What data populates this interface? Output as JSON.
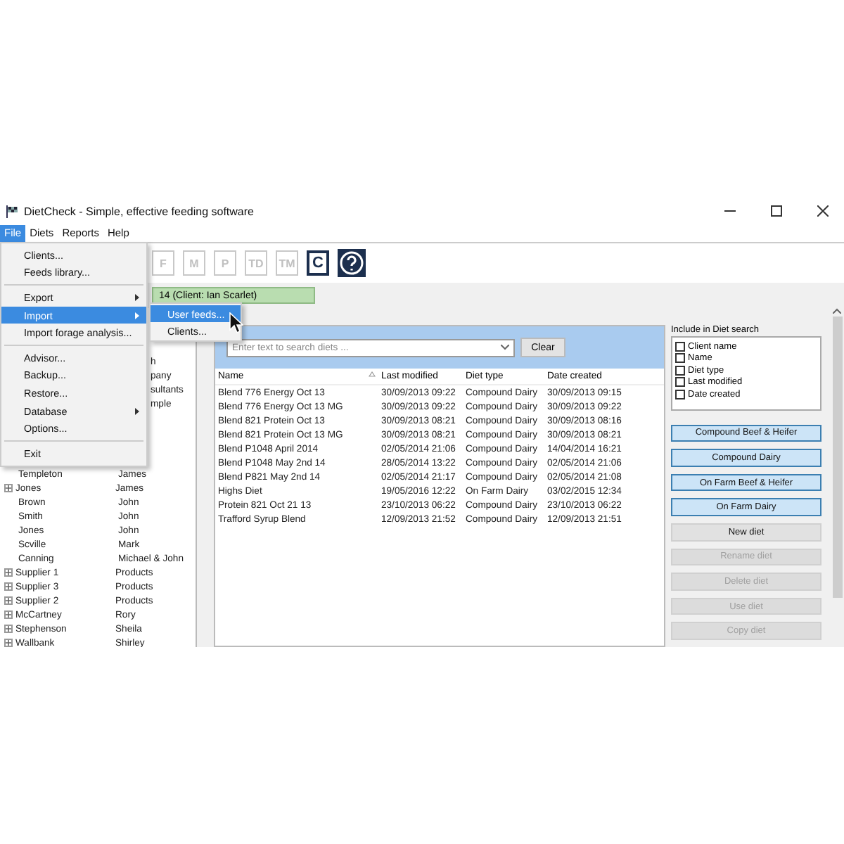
{
  "window": {
    "title": "DietCheck - Simple, effective feeding software"
  },
  "menu_bar": [
    {
      "label": "File",
      "selected": true
    },
    {
      "label": "Diets",
      "selected": false
    },
    {
      "label": "Reports",
      "selected": false
    },
    {
      "label": "Help",
      "selected": false
    }
  ],
  "file_menu": [
    {
      "kind": "item",
      "label": "Clients...",
      "selected": false,
      "submenu": false
    },
    {
      "kind": "item",
      "label": "Feeds library...",
      "selected": false,
      "submenu": false
    },
    {
      "kind": "separator"
    },
    {
      "kind": "item",
      "label": "Export",
      "selected": false,
      "submenu": true
    },
    {
      "kind": "item",
      "label": "Import",
      "selected": true,
      "submenu": true
    },
    {
      "kind": "item",
      "label": "Import forage analysis...",
      "selected": false,
      "submenu": false
    },
    {
      "kind": "separator"
    },
    {
      "kind": "item",
      "label": "Advisor...",
      "selected": false,
      "submenu": false
    },
    {
      "kind": "item",
      "label": "Backup...",
      "selected": false,
      "submenu": false
    },
    {
      "kind": "item",
      "label": "Restore...",
      "selected": false,
      "submenu": false
    },
    {
      "kind": "item",
      "label": "Database",
      "selected": false,
      "submenu": true
    },
    {
      "kind": "item",
      "label": "Options...",
      "selected": false,
      "submenu": false
    },
    {
      "kind": "separator"
    },
    {
      "kind": "item",
      "label": "Exit",
      "selected": false,
      "submenu": false
    }
  ],
  "import_submenu": [
    {
      "label": "User feeds...",
      "selected": true
    },
    {
      "label": "Clients...",
      "selected": false
    }
  ],
  "toolbar": [
    {
      "label": "F",
      "disabled": true
    },
    {
      "label": "M",
      "disabled": true
    },
    {
      "label": "P",
      "disabled": true
    },
    {
      "label": "TD",
      "disabled": true
    },
    {
      "label": "TM",
      "disabled": true
    },
    {
      "label": "C",
      "disabled": false
    }
  ],
  "banner": "14 (Client: Ian Scarlet)",
  "clients": [
    {
      "column_2": "h"
    },
    {
      "column_2": "pany"
    },
    {
      "column_2": "sultants"
    },
    {
      "column_2": "mple"
    },
    {
      "name": "Templeton",
      "first": "James",
      "expandable": false
    },
    {
      "name": "Jones",
      "first": "James",
      "expandable": true
    },
    {
      "name": "Brown",
      "first": "John",
      "expandable": false
    },
    {
      "name": "Smith",
      "first": "John",
      "expandable": false
    },
    {
      "name": "Jones",
      "first": "John",
      "expandable": false
    },
    {
      "name": "Scville",
      "first": "Mark",
      "expandable": false
    },
    {
      "name": "Canning",
      "first": "Michael & John",
      "expandable": false
    },
    {
      "name": "Supplier 1",
      "first": "Products",
      "expandable": true
    },
    {
      "name": "Supplier 3",
      "first": "Products",
      "expandable": true
    },
    {
      "name": "Supplier 2",
      "first": "Products",
      "expandable": true
    },
    {
      "name": "McCartney",
      "first": "Rory",
      "expandable": true
    },
    {
      "name": "Stephenson",
      "first": "Sheila",
      "expandable": true
    },
    {
      "name": "Wallbank",
      "first": "Shirley",
      "expandable": true
    }
  ],
  "search": {
    "placeholder": "Enter text to search diets ...",
    "button": "Clear"
  },
  "table": {
    "columns": [
      "Name",
      "Last modified",
      "Diet type",
      "Date created"
    ],
    "rows": [
      [
        "Blend 776 Energy Oct 13",
        "30/09/2013 09:22",
        "Compound Dairy",
        "30/09/2013 09:15"
      ],
      [
        "Blend 776 Energy Oct 13 MG",
        "30/09/2013 09:22",
        "Compound Dairy",
        "30/09/2013 09:22"
      ],
      [
        "Blend 821 Protein Oct 13",
        "30/09/2013 08:21",
        "Compound Dairy",
        "30/09/2013 08:16"
      ],
      [
        "Blend 821 Protein Oct 13 MG",
        "30/09/2013 08:21",
        "Compound Dairy",
        "30/09/2013 08:21"
      ],
      [
        "Blend P1048 April 2014",
        "02/05/2014 21:06",
        "Compound Dairy",
        "14/04/2014 16:21"
      ],
      [
        "Blend P1048 May 2nd 14",
        "28/05/2014 13:22",
        "Compound Dairy",
        "02/05/2014 21:06"
      ],
      [
        "Blend P821 May 2nd 14",
        "02/05/2014 21:17",
        "Compound Dairy",
        "02/05/2014 21:08"
      ],
      [
        "Highs Diet",
        "19/05/2016 12:22",
        "On Farm Dairy",
        "03/02/2015 12:34"
      ],
      [
        "Protein 821 Oct 21 13",
        "23/10/2013 06:22",
        "Compound Dairy",
        "23/10/2013 06:22"
      ],
      [
        "Trafford Syrup Blend",
        "12/09/2013 21:52",
        "Compound Dairy",
        "12/09/2013 21:51"
      ]
    ]
  },
  "include_search": {
    "title": "Include in Diet search",
    "options": [
      {
        "label": "Client name",
        "checked": false
      },
      {
        "label": "Name",
        "checked": false
      },
      {
        "label": "Diet type",
        "checked": false
      },
      {
        "label": "Last modified",
        "checked": false
      },
      {
        "label": "Date created",
        "checked": false
      }
    ]
  },
  "buttons": [
    {
      "kind": "type",
      "label": "Compound Beef & Heifer",
      "disabled": false
    },
    {
      "kind": "type",
      "label": "Compound Dairy",
      "disabled": false
    },
    {
      "kind": "type",
      "label": "On Farm Beef & Heifer",
      "disabled": false
    },
    {
      "kind": "type",
      "label": "On Farm Dairy",
      "disabled": false
    },
    {
      "kind": "action",
      "label": "New diet",
      "disabled": false
    },
    {
      "kind": "action",
      "label": "Rename diet",
      "disabled": true
    },
    {
      "kind": "action",
      "label": "Delete diet",
      "disabled": true
    },
    {
      "kind": "action",
      "label": "Use diet",
      "disabled": true
    },
    {
      "kind": "action",
      "label": "Copy diet",
      "disabled": true
    }
  ]
}
